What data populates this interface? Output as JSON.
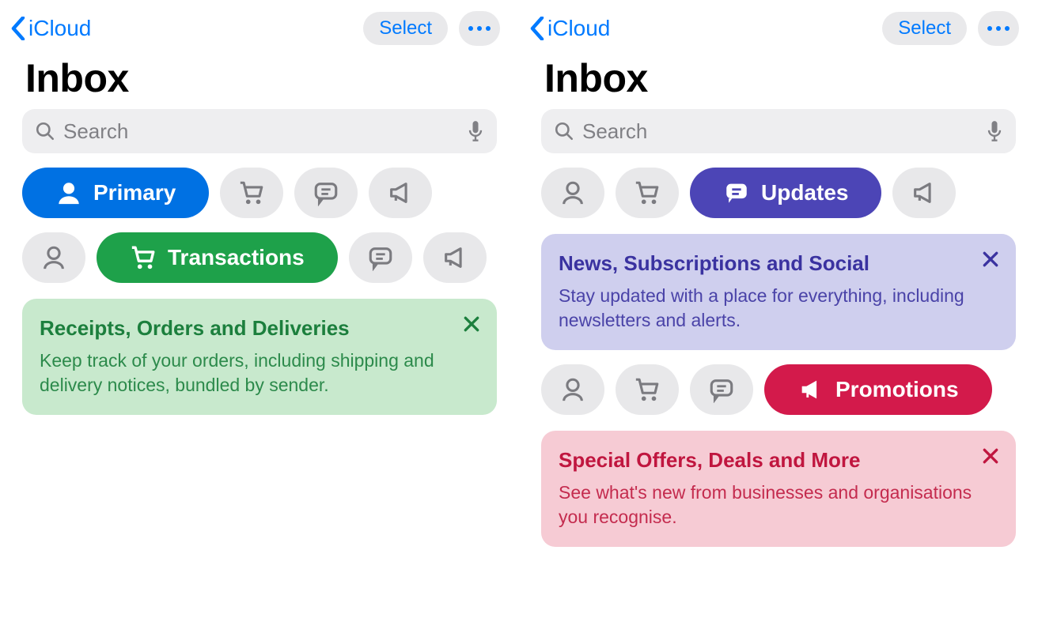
{
  "left": {
    "nav": {
      "back_label": "iCloud",
      "select_label": "Select"
    },
    "title": "Inbox",
    "search": {
      "placeholder": "Search"
    },
    "row1": {
      "active_label": "Primary",
      "active_kind": "primary"
    },
    "row2": {
      "active_label": "Transactions",
      "active_kind": "transactions"
    },
    "card": {
      "title": "Receipts, Orders and Deliveries",
      "desc": "Keep track of your orders, including shipping and delivery notices, bundled by sender."
    }
  },
  "right": {
    "nav": {
      "back_label": "iCloud",
      "select_label": "Select"
    },
    "title": "Inbox",
    "search": {
      "placeholder": "Search"
    },
    "row1": {
      "active_label": "Updates",
      "active_kind": "updates"
    },
    "card1": {
      "title": "News, Subscriptions and Social",
      "desc": "Stay updated with a place for everything, including newsletters and alerts."
    },
    "row2": {
      "active_label": "Promotions",
      "active_kind": "promotions"
    },
    "card2": {
      "title": "Special Offers, Deals and More",
      "desc": "See what's new from businesses and organisations you recognise."
    }
  }
}
